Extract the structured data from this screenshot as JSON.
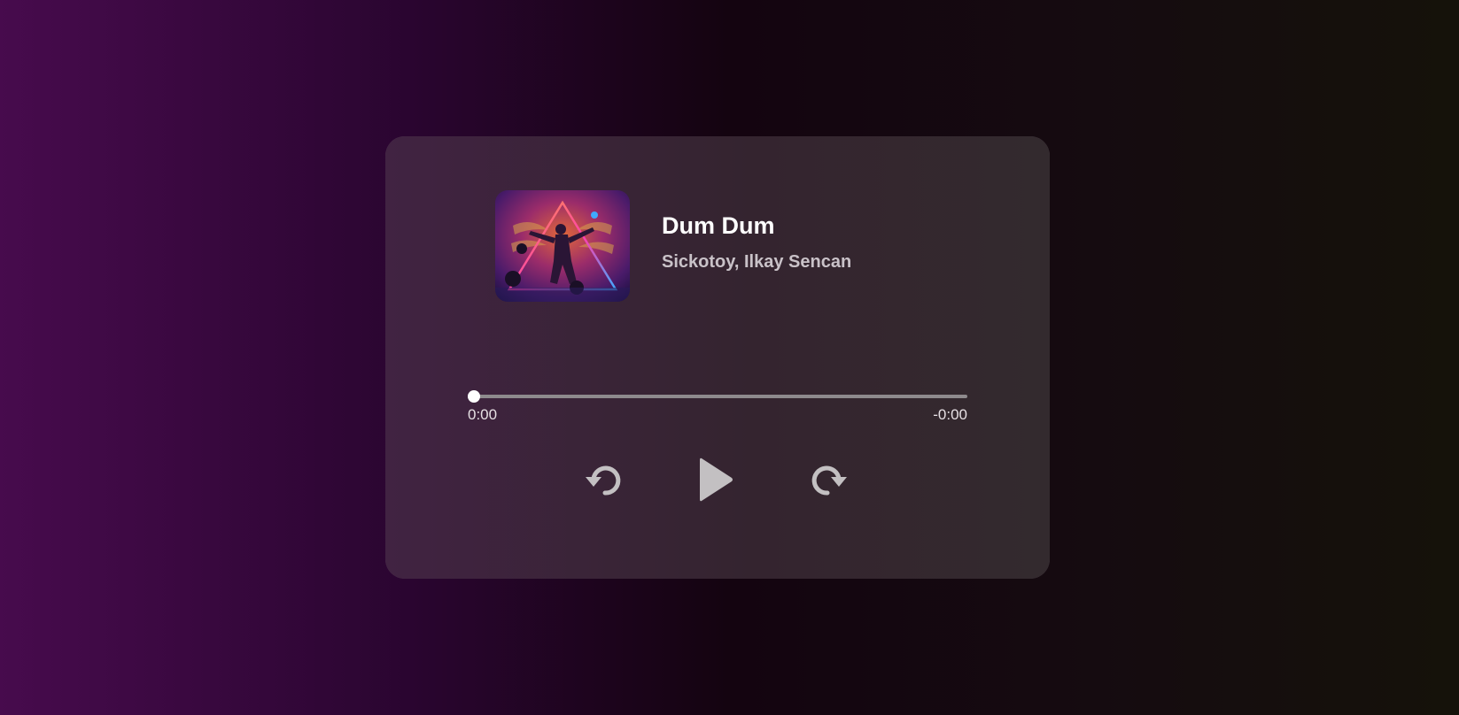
{
  "player": {
    "track": {
      "title": "Dum Dum",
      "artist": "Sickotoy, Ilkay Sencan",
      "artwork": "album-art"
    },
    "progress": {
      "fraction": 0.0,
      "current_time": "0:00",
      "remaining_time": "-0:00"
    },
    "controls": {
      "rewind_icon": "rewind-icon",
      "play_icon": "play-icon",
      "forward_icon": "forward-icon"
    },
    "colors": {
      "card": "#3a2639",
      "text_primary": "#ffffff",
      "text_secondary": "#c9c2c8",
      "control_icon": "#c3c0c2",
      "track": "#8e8a8d"
    }
  }
}
